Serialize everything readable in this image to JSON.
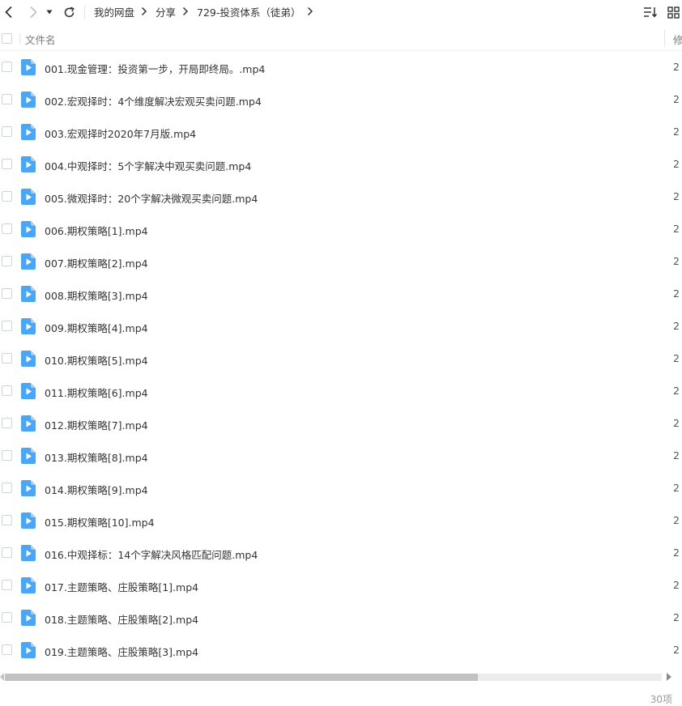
{
  "toolbar": {
    "back_icon": "chevron-left-icon",
    "forward_icon": "chevron-right-icon",
    "history_dropdown_icon": "caret-down-icon",
    "refresh_icon": "refresh-icon",
    "breadcrumb": [
      "我的网盘",
      "分享",
      "729-投资体系（徒弟）"
    ],
    "sort_icon": "sort-list-icon",
    "grid_view_icon": "grid-view-icon"
  },
  "list": {
    "header_name": "文件名",
    "header_modified": "修",
    "files": [
      {
        "name": "001.现金管理：投资第一步，开局即终局。.mp4",
        "modified": "2"
      },
      {
        "name": "002.宏观择时：4个维度解决宏观买卖问题.mp4",
        "modified": "2"
      },
      {
        "name": "003.宏观择时2020年7月版.mp4",
        "modified": "2"
      },
      {
        "name": "004.中观择时：5个字解决中观买卖问题.mp4",
        "modified": "2"
      },
      {
        "name": "005.微观择时：20个字解决微观买卖问题.mp4",
        "modified": "2"
      },
      {
        "name": "006.期权策略[1].mp4",
        "modified": "2"
      },
      {
        "name": "007.期权策略[2].mp4",
        "modified": "2"
      },
      {
        "name": "008.期权策略[3].mp4",
        "modified": "2"
      },
      {
        "name": "009.期权策略[4].mp4",
        "modified": "2"
      },
      {
        "name": "010.期权策略[5].mp4",
        "modified": "2"
      },
      {
        "name": "011.期权策略[6].mp4",
        "modified": "2"
      },
      {
        "name": "012.期权策略[7].mp4",
        "modified": "2"
      },
      {
        "name": "013.期权策略[8].mp4",
        "modified": "2"
      },
      {
        "name": "014.期权策略[9].mp4",
        "modified": "2"
      },
      {
        "name": "015.期权策略[10].mp4",
        "modified": "2"
      },
      {
        "name": "016.中观择标：14个字解决风格匹配问题.mp4",
        "modified": "2"
      },
      {
        "name": "017.主题策略、庄股策略[1].mp4",
        "modified": "2"
      },
      {
        "name": "018.主题策略、庄股策略[2].mp4",
        "modified": "2"
      },
      {
        "name": "019.主题策略、庄股策略[3].mp4",
        "modified": "2"
      }
    ]
  },
  "scrollbar": {
    "horizontal_position_fraction": 0.72
  },
  "status": {
    "item_count": "30项"
  },
  "colors": {
    "file_icon_blue": "#4aa7f5",
    "text": "#333333",
    "muted": "#999999"
  }
}
